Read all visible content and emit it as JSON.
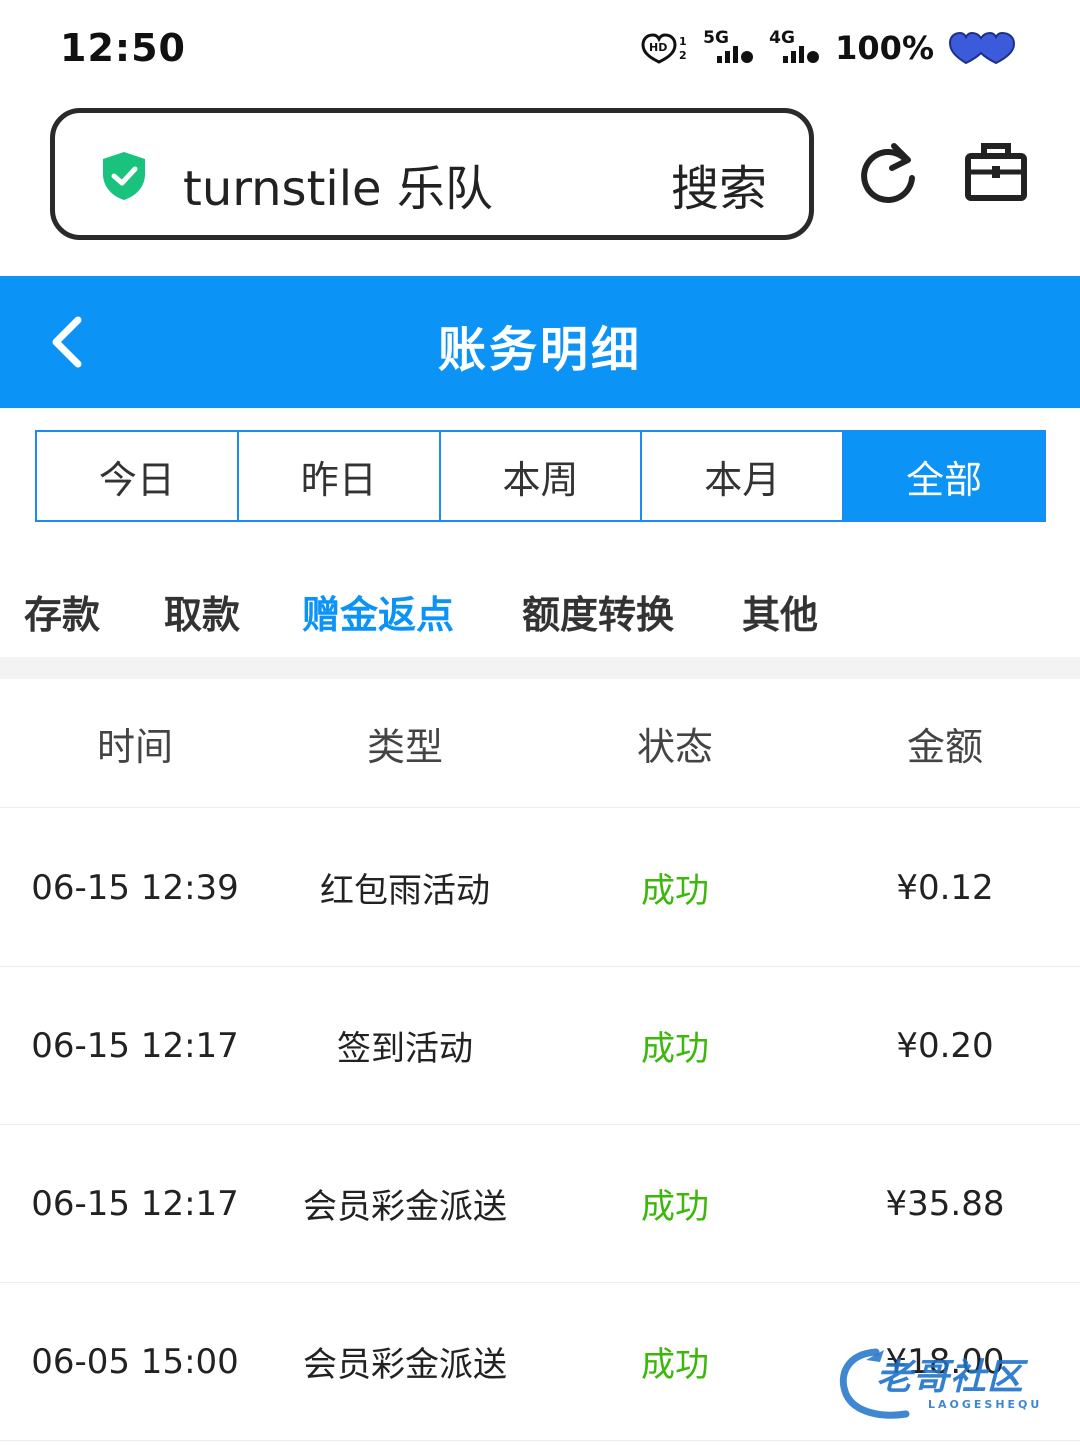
{
  "status_bar": {
    "time": "12:50",
    "hd_label": "HD",
    "sim1_label": "1",
    "sim2_label": "2",
    "net1": "5G",
    "net2": "4G",
    "battery": "100%"
  },
  "browser": {
    "search_query": "turnstile 乐队",
    "search_button": "搜索"
  },
  "header": {
    "title": "账务明细"
  },
  "period_tabs": [
    {
      "label": "今日",
      "active": false
    },
    {
      "label": "昨日",
      "active": false
    },
    {
      "label": "本周",
      "active": false
    },
    {
      "label": "本月",
      "active": false
    },
    {
      "label": "全部",
      "active": true
    }
  ],
  "category_tabs": [
    {
      "label": "存款",
      "active": false
    },
    {
      "label": "取款",
      "active": false
    },
    {
      "label": "赠金返点",
      "active": true
    },
    {
      "label": "额度转换",
      "active": false
    },
    {
      "label": "其他",
      "active": false
    }
  ],
  "table": {
    "columns": [
      "时间",
      "类型",
      "状态",
      "金额"
    ],
    "rows": [
      {
        "time": "06-15 12:39",
        "type": "红包雨活动",
        "status": "成功",
        "amount": "¥0.12"
      },
      {
        "time": "06-15 12:17",
        "type": "签到活动",
        "status": "成功",
        "amount": "¥0.20"
      },
      {
        "time": "06-15 12:17",
        "type": "会员彩金派送",
        "status": "成功",
        "amount": "¥35.88"
      },
      {
        "time": "06-05 15:00",
        "type": "会员彩金派送",
        "status": "成功",
        "amount": "¥18.00"
      }
    ]
  },
  "watermark": {
    "text": "老哥社区",
    "subtext": "LAOGESHEQU"
  },
  "colors": {
    "accent": "#0b93f6",
    "success": "#3cb80a",
    "shield": "#19c37d",
    "heart": "#3b5bdb"
  },
  "icons": [
    "hd-voice-icon",
    "signal-5g-icon",
    "signal-4g-icon",
    "battery-heart-icon",
    "shield-check-icon",
    "refresh-icon",
    "toolbox-icon",
    "back-chevron-icon"
  ]
}
